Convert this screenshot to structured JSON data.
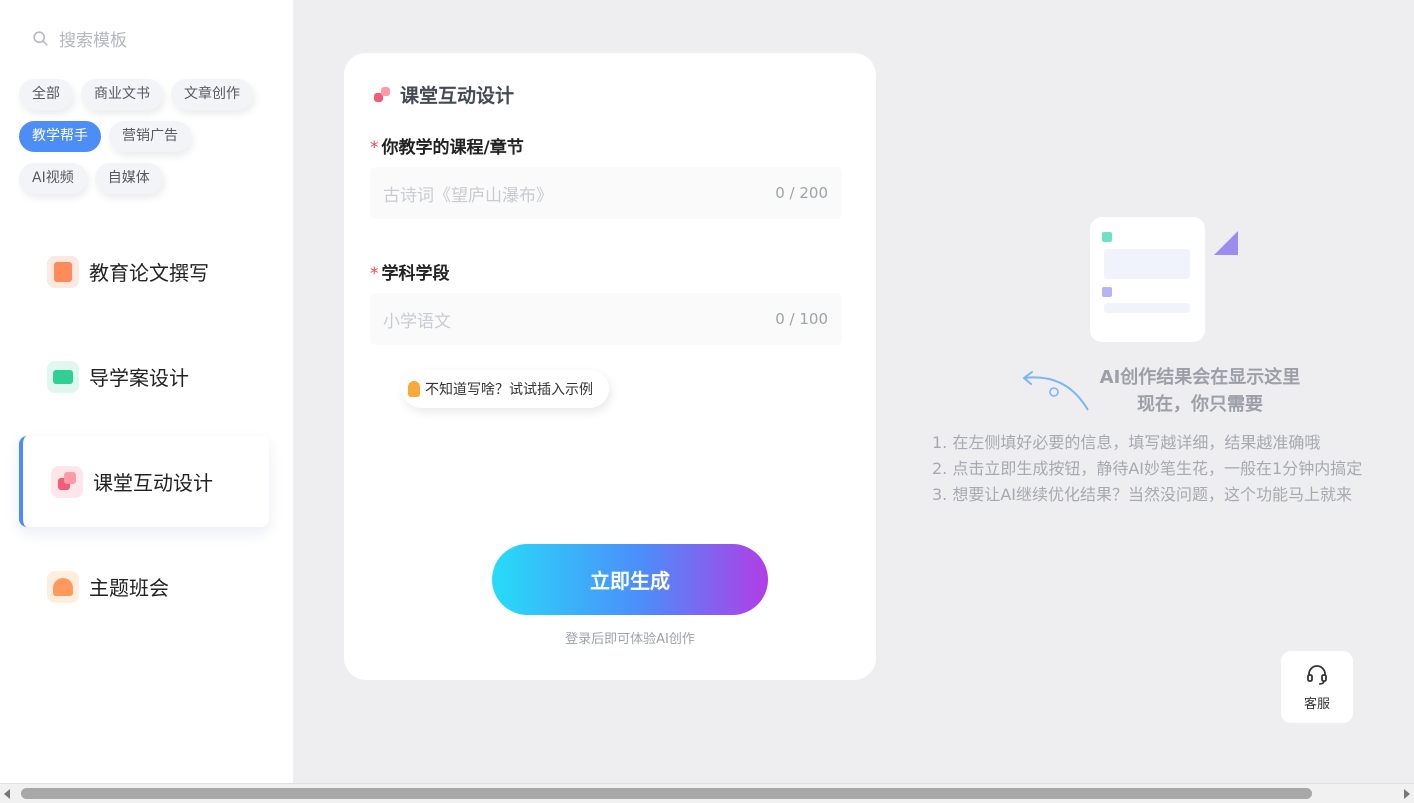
{
  "sidebar": {
    "search_placeholder": "搜索模板",
    "tags": [
      "全部",
      "商业文书",
      "文章创作",
      "教学帮手",
      "营销广告",
      "AI视频",
      "自媒体"
    ],
    "active_tag": "教学帮手",
    "menu": [
      {
        "label": "教育论文撰写",
        "icon": "paper-edit-icon"
      },
      {
        "label": "导学案设计",
        "icon": "presentation-board-icon"
      },
      {
        "label": "课堂互动设计",
        "icon": "interaction-blocks-icon"
      },
      {
        "label": "主题班会",
        "icon": "class-meeting-icon"
      }
    ],
    "active_menu": "课堂互动设计"
  },
  "form": {
    "title": "课堂互动设计",
    "fields": [
      {
        "label": "你教学的课程/章节",
        "required": "*",
        "placeholder": "古诗词《望庐山瀑布》",
        "count": "0 / 200"
      },
      {
        "label": "学科学段",
        "required": "*",
        "placeholder": "小学语文",
        "count": "0 / 100"
      }
    ],
    "hint": "不知道写啥？试试插入示例",
    "generate_label": "立即生成",
    "login_note": "登录后即可体验AI创作"
  },
  "result": {
    "title_line1": "AI创作结果会在显示这里",
    "title_line2": "现在，你只需要",
    "steps": [
      "1. 在左侧填好必要的信息，填写越详细，结果越准确哦",
      "2. 点击立即生成按钮，静待AI妙笔生花，一般在1分钟内搞定",
      "3. 想要让AI继续优化结果？当然没问题，这个功能马上就来"
    ]
  },
  "support": {
    "label": "客服",
    "icon": "headset-icon"
  },
  "colors": {
    "accent": "#4c8df6",
    "required": "#f04848",
    "gradient_start": "#27dcf8",
    "gradient_end": "#b13ee6"
  }
}
